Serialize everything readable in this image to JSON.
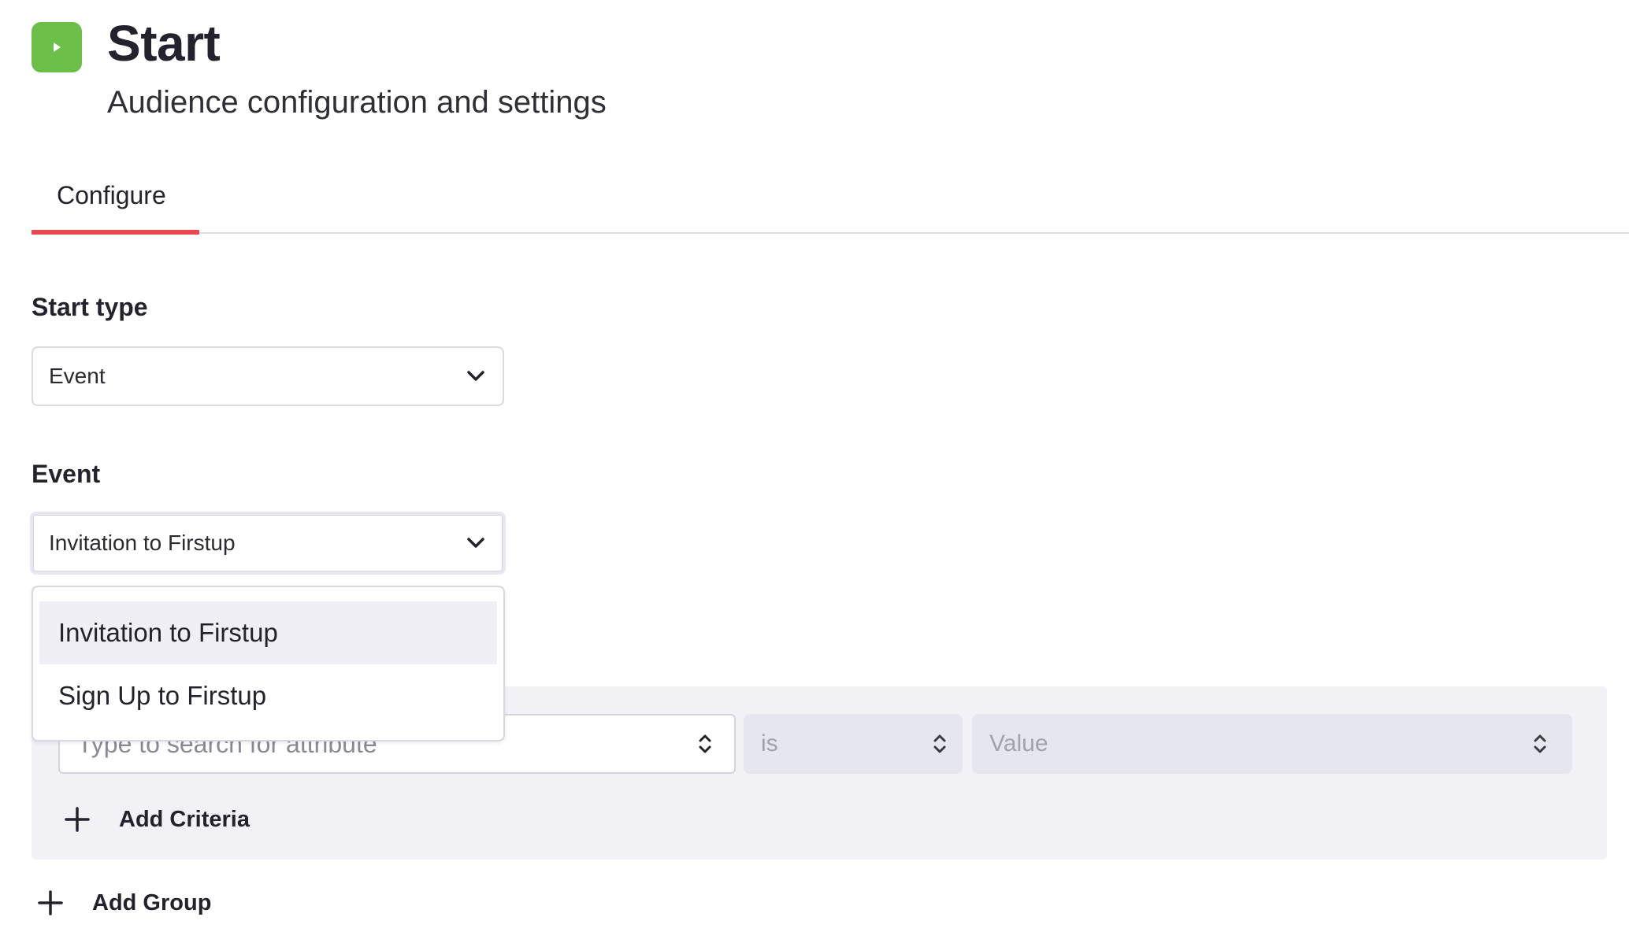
{
  "header": {
    "title": "Start",
    "subtitle": "Audience configuration and settings",
    "badge_color": "#6cc04a",
    "badge_icon": "play-icon"
  },
  "tabs": [
    {
      "label": "Configure",
      "active": true,
      "underline_color": "#e8474f"
    }
  ],
  "start_type": {
    "label": "Start type",
    "value": "Event"
  },
  "event": {
    "label": "Event",
    "value": "Invitation to Firstup",
    "options": [
      {
        "label": "Invitation to Firstup",
        "selected": true
      },
      {
        "label": "Sign Up to Firstup",
        "selected": false
      }
    ]
  },
  "criteria": {
    "attribute_placeholder": "Type to search for attribute",
    "operator_placeholder": "is",
    "value_placeholder": "Value",
    "add_criteria_label": "Add Criteria"
  },
  "add_group_label": "Add Group"
}
